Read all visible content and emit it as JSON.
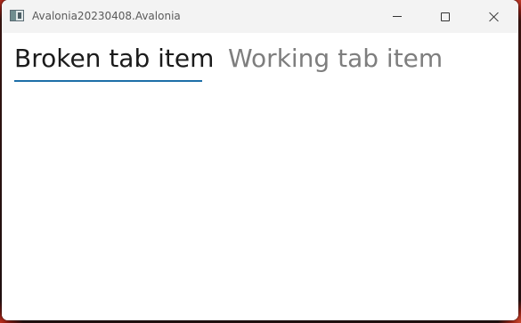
{
  "window": {
    "title": "Avalonia20230408.Avalonia"
  },
  "caption_buttons": {
    "minimize": "minimize-icon",
    "maximize": "maximize-icon",
    "close": "close-icon"
  },
  "tabs": [
    {
      "label": "Broken tab item",
      "selected": true
    },
    {
      "label": "Working tab item",
      "selected": false
    }
  ],
  "colors": {
    "accent": "#1d6fa8",
    "selected_tab_text": "#1b1b1b",
    "unselected_tab_text": "#7e7e7e",
    "titlebar": "#f3f3f3"
  }
}
